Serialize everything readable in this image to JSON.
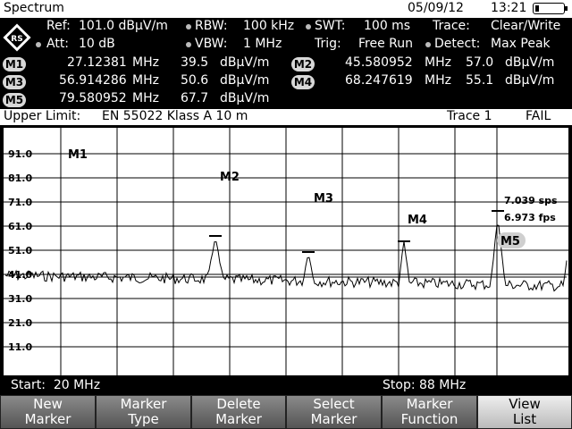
{
  "titlebar": {
    "title": "Spectrum",
    "date": "05/09/12",
    "time": "13:21"
  },
  "settings": {
    "ref_label": "Ref:",
    "ref_value": "101.0 dBµV/m",
    "rbw_label": "RBW:",
    "rbw_value": "100 kHz",
    "swt_label": "SWT:",
    "swt_value": "100 ms",
    "trace_label": "Trace:",
    "trace_value": "Clear/Write",
    "att_label": "Att:",
    "att_value": "10 dB",
    "vbw_label": "VBW:",
    "vbw_value": "1 MHz",
    "trig_label": "Trig:",
    "trig_value": "Free Run",
    "detect_label": "Detect:",
    "detect_value": "Max Peak"
  },
  "markers": [
    {
      "badge": "M1",
      "freq": "27.12381",
      "unit": "MHz",
      "level": "39.5",
      "level_unit": "dBµV/m"
    },
    {
      "badge": "M2",
      "freq": "45.580952",
      "unit": "MHz",
      "level": "57.0",
      "level_unit": "dBµV/m"
    },
    {
      "badge": "M3",
      "freq": "56.914286",
      "unit": "MHz",
      "level": "50.6",
      "level_unit": "dBµV/m"
    },
    {
      "badge": "M4",
      "freq": "68.247619",
      "unit": "MHz",
      "level": "55.1",
      "level_unit": "dBµV/m"
    },
    {
      "badge": "M5",
      "freq": "79.580952",
      "unit": "MHz",
      "level": "67.7",
      "level_unit": "dBµV/m"
    }
  ],
  "status": {
    "limit_label": "Upper Limit:",
    "limit_value": "EN 55022 Klass A 10 m",
    "trace": "Trace 1",
    "result": "FAIL"
  },
  "plot": {
    "y_ticks": [
      "91.0",
      "81.0",
      "71.0",
      "61.0",
      "51.0",
      "41.0",
      "31.0",
      "21.0",
      "11.0"
    ],
    "marker_labels": [
      "M1",
      "M2",
      "M3",
      "M4",
      "M5"
    ],
    "rate_sps": "7.039 sps",
    "rate_fps": "6.973 fps"
  },
  "span": {
    "start": "Start:  20 MHz",
    "stop": "Stop: 88 MHz"
  },
  "softkeys": [
    {
      "line1": "New",
      "line2": "Marker"
    },
    {
      "line1": "Marker",
      "line2": "Type"
    },
    {
      "line1": "Delete",
      "line2": "Marker"
    },
    {
      "line1": "Select",
      "line2": "Marker"
    },
    {
      "line1": "Marker",
      "line2": "Function"
    },
    {
      "line1": "View",
      "line2": "List"
    }
  ],
  "colors": {
    "background": "#000000",
    "plot_bg": "#ffffff",
    "fail": "#000000"
  }
}
